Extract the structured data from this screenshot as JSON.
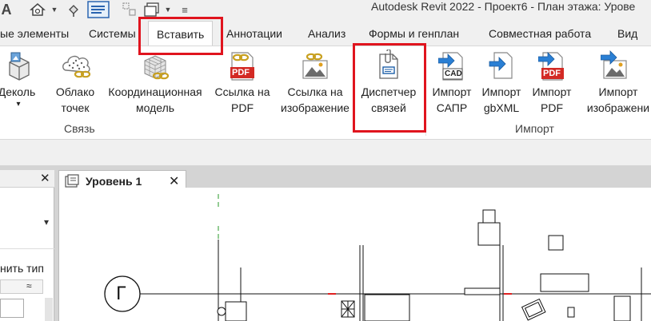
{
  "window": {
    "app_icon_letter": "A",
    "title": "Autodesk Revit 2022 - Проект6 - План этажа: Урове"
  },
  "tabs": [
    {
      "label": "ые элементы"
    },
    {
      "label": "Системы"
    },
    {
      "label": "Вставить",
      "active": true
    },
    {
      "label": "Аннотации"
    },
    {
      "label": "Анализ"
    },
    {
      "label": "Формы и генплан"
    },
    {
      "label": "Совместная работа"
    },
    {
      "label": "Вид"
    }
  ],
  "ribbon": {
    "tools": [
      {
        "line1": "Деколь",
        "line2": "▾"
      },
      {
        "line1": "Облако",
        "line2": "точек"
      },
      {
        "line1": "Координационная",
        "line2": "модель"
      },
      {
        "line1": "Ссылка на",
        "line2": "PDF"
      },
      {
        "line1": "Ссылка на",
        "line2": "изображение"
      },
      {
        "line1": "Диспетчер",
        "line2": "связей"
      },
      {
        "line1": "Импорт",
        "line2": "САПР"
      },
      {
        "line1": "Импорт",
        "line2": "gbXML"
      },
      {
        "line1": "Импорт",
        "line2": "PDF"
      },
      {
        "line1": "Импорт",
        "line2": "изображени"
      }
    ],
    "icon_texts": {
      "pdf": "PDF",
      "cad": "CAD"
    },
    "panels": {
      "link": "Связь",
      "import": "Импорт"
    }
  },
  "left_panel": {
    "close": "✕",
    "dropdown": "▾",
    "edit_type": "нить тип",
    "collapse": "≈"
  },
  "view": {
    "tab_title": "Уровень 1",
    "close": "✕",
    "grid_bubble": "Г"
  },
  "colors": {
    "highlight": "#e0141e",
    "active_tab_bg": "#ffffff",
    "chrome_bg": "#f0f0f0"
  }
}
